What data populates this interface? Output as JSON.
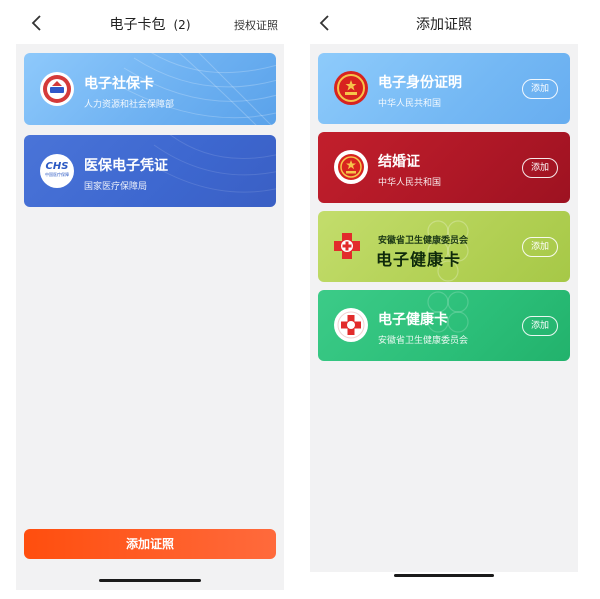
{
  "colors": {
    "social_card": "#72b6f3",
    "medical_card": "#3d6ad2",
    "id_card": "#7cbcf5",
    "marriage_card": "#b01828",
    "health_yellow_card": "#b4d257",
    "health_green_card": "#2ec07a",
    "add_button": "#ff5a21"
  },
  "left": {
    "nav": {
      "title": "电子卡包",
      "count": "(2)",
      "right": "授权证照"
    },
    "cards": [
      {
        "title": "电子社保卡",
        "subtitle": "人力资源和社会保障部",
        "icon": "social-security-emblem-icon"
      },
      {
        "title": "医保电子凭证",
        "subtitle": "国家医疗保障局",
        "icon_text": "CHS",
        "icon_small": "中国医疗保障",
        "icon": "chs-logo-icon"
      }
    ],
    "add_button": "添加证照"
  },
  "right": {
    "nav": {
      "title": "添加证照"
    },
    "cards": [
      {
        "title": "电子身份证明",
        "subtitle": "中华人民共和国",
        "button": "添加",
        "icon": "national-emblem-icon"
      },
      {
        "title": "结婚证",
        "subtitle": "中华人民共和国",
        "button": "添加",
        "icon": "national-emblem-icon"
      },
      {
        "line1": "安徽省卫生健康委员会",
        "line2": "电子健康卡",
        "button": "添加",
        "icon": "red-cross-icon"
      },
      {
        "title": "电子健康卡",
        "subtitle": "安徽省卫生健康委员会",
        "button": "添加",
        "icon": "red-cross-icon"
      }
    ]
  }
}
